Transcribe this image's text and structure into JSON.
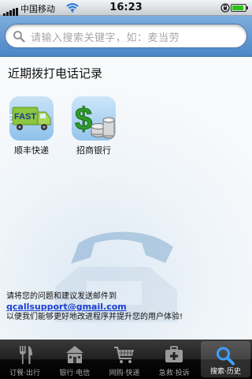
{
  "status_bar": {
    "carrier": "中国移动",
    "time": "16:23",
    "signal_icon": "signal-bars-icon",
    "wifi_icon": "wifi-icon",
    "lock_icon": "rotation-lock-icon",
    "battery_level": 0.9
  },
  "search": {
    "placeholder": "请输入搜索关键字，如：麦当劳",
    "icon": "search-icon"
  },
  "recent_calls": {
    "title": "近期拨打电话记录",
    "items": [
      {
        "label": "顺丰快递",
        "icon": "fast-delivery-truck-icon"
      },
      {
        "label": "招商银行",
        "icon": "dollar-coins-icon"
      }
    ]
  },
  "contact": {
    "line1": "请将您的问题和建议发送邮件到",
    "email": "qcallsupport@gmail.com",
    "line2": "以便我们能够更好地改进程序并提升您的用户体验!"
  },
  "tabs": [
    {
      "label": "订餐·出行",
      "icon": "fork-knife-icon",
      "active": false
    },
    {
      "label": "银行·电信",
      "icon": "bank-building-icon",
      "active": false
    },
    {
      "label": "网购·快递",
      "icon": "shopping-cart-icon",
      "active": false
    },
    {
      "label": "急救·投诉",
      "icon": "first-aid-kit-icon",
      "active": false
    },
    {
      "label": "搜索·历史",
      "icon": "search-icon",
      "active": true
    }
  ],
  "colors": {
    "search_bar": "#5c95d3",
    "link": "#1a3fd1",
    "tab_bar": "#1a1a1a"
  }
}
